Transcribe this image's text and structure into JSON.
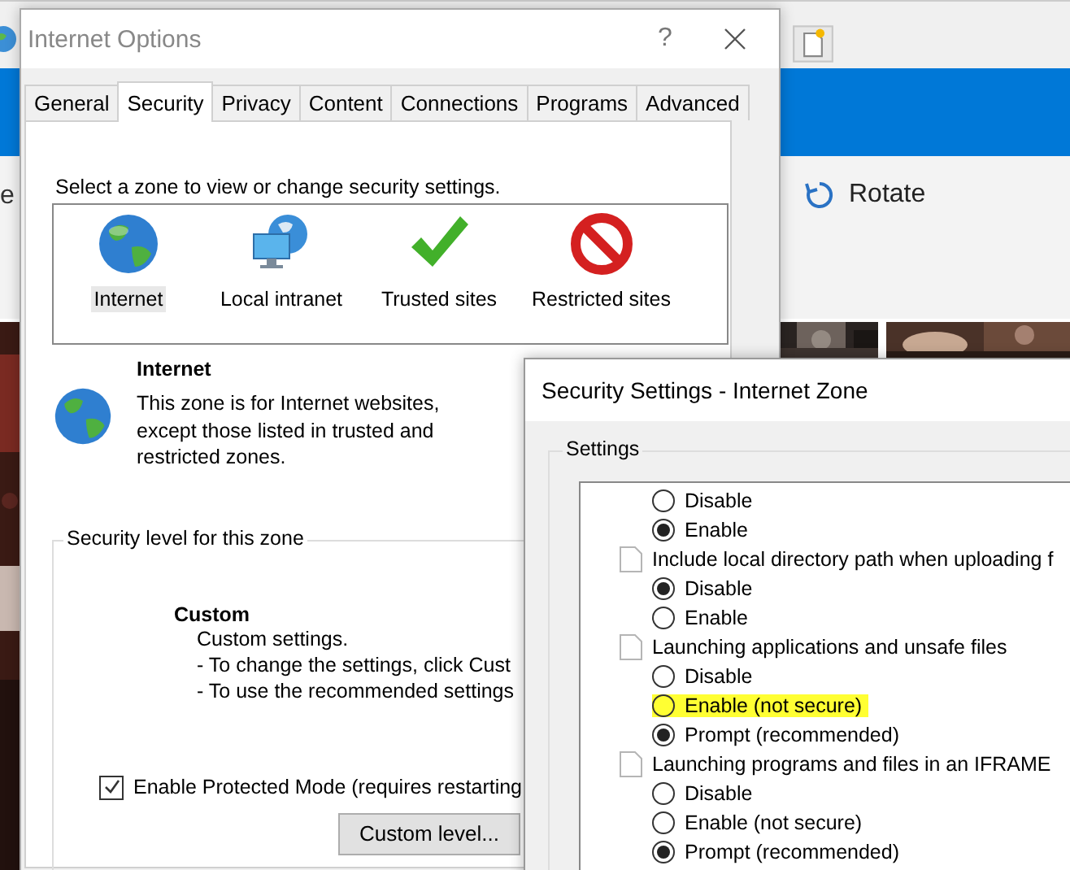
{
  "background_app": {
    "cut_text": "e",
    "rotate_button": "Rotate"
  },
  "internet_options": {
    "title": "Internet Options",
    "help": "?",
    "tabs": [
      {
        "label": "General",
        "selected": false
      },
      {
        "label": "Security",
        "selected": true
      },
      {
        "label": "Privacy",
        "selected": false
      },
      {
        "label": "Content",
        "selected": false
      },
      {
        "label": "Connections",
        "selected": false
      },
      {
        "label": "Programs",
        "selected": false
      },
      {
        "label": "Advanced",
        "selected": false
      }
    ],
    "zone_prompt": "Select a zone to view or change security settings.",
    "zones": [
      {
        "label": "Internet",
        "kind": "globe",
        "selected": true
      },
      {
        "label": "Local intranet",
        "kind": "intranet",
        "selected": false
      },
      {
        "label": "Trusted sites",
        "kind": "trusted",
        "selected": false
      },
      {
        "label": "Restricted sites",
        "kind": "restricted",
        "selected": false
      }
    ],
    "zone_info": {
      "title": "Internet",
      "description": "This zone is for Internet websites, except those listed in trusted and restricted zones."
    },
    "security_level": {
      "legend": "Security level for this zone",
      "level_name": "Custom",
      "lines": [
        "Custom settings.",
        "- To change the settings, click Cust",
        "- To use the recommended settings"
      ]
    },
    "protected_mode": {
      "label": "Enable Protected Mode (requires restarting",
      "checked": true
    },
    "custom_level_button": "Custom level..."
  },
  "security_settings": {
    "title": "Security Settings - Internet Zone",
    "settings_legend": "Settings",
    "items": [
      {
        "kind": "option",
        "label": "Disable",
        "selected": false,
        "highlighted": false
      },
      {
        "kind": "option",
        "label": "Enable",
        "selected": true,
        "highlighted": false
      },
      {
        "kind": "heading",
        "label": "Include local directory path when uploading f"
      },
      {
        "kind": "option",
        "label": "Disable",
        "selected": true,
        "highlighted": false
      },
      {
        "kind": "option",
        "label": "Enable",
        "selected": false,
        "highlighted": false
      },
      {
        "kind": "heading",
        "label": "Launching applications and unsafe files"
      },
      {
        "kind": "option",
        "label": "Disable",
        "selected": false,
        "highlighted": false
      },
      {
        "kind": "option",
        "label": "Enable (not secure)",
        "selected": false,
        "highlighted": true
      },
      {
        "kind": "option",
        "label": "Prompt (recommended)",
        "selected": true,
        "highlighted": false
      },
      {
        "kind": "heading",
        "label": "Launching programs and files in an IFRAME"
      },
      {
        "kind": "option",
        "label": "Disable",
        "selected": false,
        "highlighted": false
      },
      {
        "kind": "option",
        "label": "Enable (not secure)",
        "selected": false,
        "highlighted": false
      },
      {
        "kind": "option",
        "label": "Prompt (recommended)",
        "selected": true,
        "highlighted": false
      }
    ]
  }
}
